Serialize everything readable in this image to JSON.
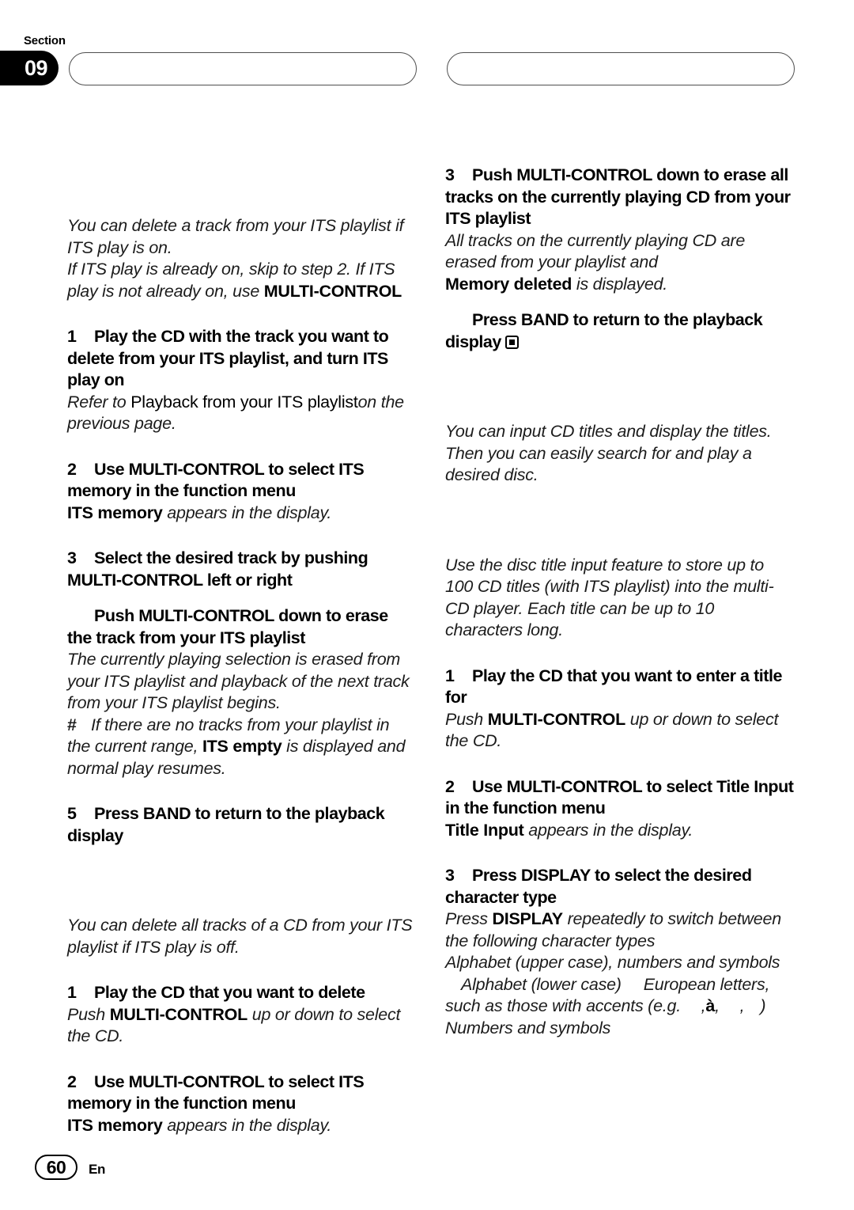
{
  "header": {
    "section_label": "Section",
    "section_number": "09",
    "left_box_title": "",
    "right_box_title": ""
  },
  "footer": {
    "page_number": "60",
    "language": "En"
  },
  "left_column": {
    "intro_1": "You can delete a track from your ITS playlist if ITS play is on.",
    "intro_2_a": "If ITS play is already on, skip to step 2. If ITS play is not already on, use ",
    "intro_2_b": "MULTI-CONTROL",
    "step1_num": "1",
    "step1_text": "Play the CD with the track you want to delete from your ITS playlist, and turn ITS play on",
    "step1_note_a": "Refer to ",
    "step1_note_b": "Playback from your ITS playlist",
    "step1_note_c": "on the previous page.",
    "step2_num": "2",
    "step2_text": "Use MULTI-CONTROL to select ITS memory in the function menu",
    "step2_note_bold": "ITS memory",
    "step2_note_rest": " appears in the display.",
    "step3_num": "3",
    "step3_text": "Select the desired track by pushing MULTI-CONTROL left or right",
    "step4_num": "",
    "step4_text": "Push MULTI-CONTROL down to erase the track from your ITS playlist",
    "step4_note": "The currently playing selection is erased from your ITS playlist and playback of the next track from your ITS playlist begins.",
    "bullet_marker": "#",
    "bullet_a": "If there are no tracks from your playlist in the current range, ",
    "bullet_b": "ITS empty",
    "bullet_c": " is displayed and normal play resumes.",
    "step5_num": "5",
    "step5_text": "Press BAND to return to the playback display",
    "section2_heading": "",
    "section2_intro": "You can delete all tracks of a CD from your ITS playlist if ITS play is off.",
    "s2_step1_num": "1",
    "s2_step1_text": "Play the CD that you want to delete",
    "s2_step1_note_a": "Push ",
    "s2_step1_note_b": "MULTI-CONTROL",
    "s2_step1_note_c": " up or down to select the CD.",
    "s2_step2_num": "2",
    "s2_step2_text": "Use MULTI-CONTROL to select ITS memory in the function menu",
    "s2_step2_note_bold": "ITS memory",
    "s2_step2_note_rest": " appears in the display."
  },
  "right_column": {
    "step3_num": "3",
    "step3_text": "Push MULTI-CONTROL down to erase all tracks on the currently playing CD from your ITS playlist",
    "step3_note_1": "All tracks on the currently playing CD are erased from your playlist and",
    "step3_note_2_bold": "Memory deleted",
    "step3_note_2_rest": " is displayed.",
    "step4_num": "",
    "step4_text": "Press BAND to return to the playback display",
    "end_marker_icon": "filled-square-in-box",
    "section3_heading": "",
    "section3_intro": "You can input CD titles and display the titles. Then you can easily search for and play a desired disc.",
    "section4_heading": "",
    "section4_intro": "Use the disc title input feature to store up to 100 CD titles  (with ITS playlist) into the multi-CD player. Each title can be up to 10 characters long.",
    "s4_step1_num": "1",
    "s4_step1_text": "Play the CD that you want to enter a title for",
    "s4_step1_note_a": "Push ",
    "s4_step1_note_b": "MULTI-CONTROL",
    "s4_step1_note_c": " up or down to select the CD.",
    "s4_step2_num": "2",
    "s4_step2_text": "Use MULTI-CONTROL to select Title Input in the function menu",
    "s4_step2_note_bold": "Title Input",
    "s4_step2_note_rest": " appears in the display.",
    "s4_step3_num": "3",
    "s4_step3_text": "Press DISPLAY to select the desired character type",
    "s4_step3_note_a": "Press ",
    "s4_step3_note_b": "DISPLAY",
    "s4_step3_note_c": " repeatedly to switch between the following character types",
    "char_type_1": "Alphabet (upper case), numbers and symbols",
    "char_type_2_a": "Alphabet (lower case)",
    "char_type_2_b": "European letters, such as those with accents (e.g. ",
    "char_type_2_accent": "à",
    "char_type_2_c": ",",
    "char_type_2_d": ", ",
    "char_type_2_e": ")",
    "char_type_3": "Numbers and symbols"
  }
}
